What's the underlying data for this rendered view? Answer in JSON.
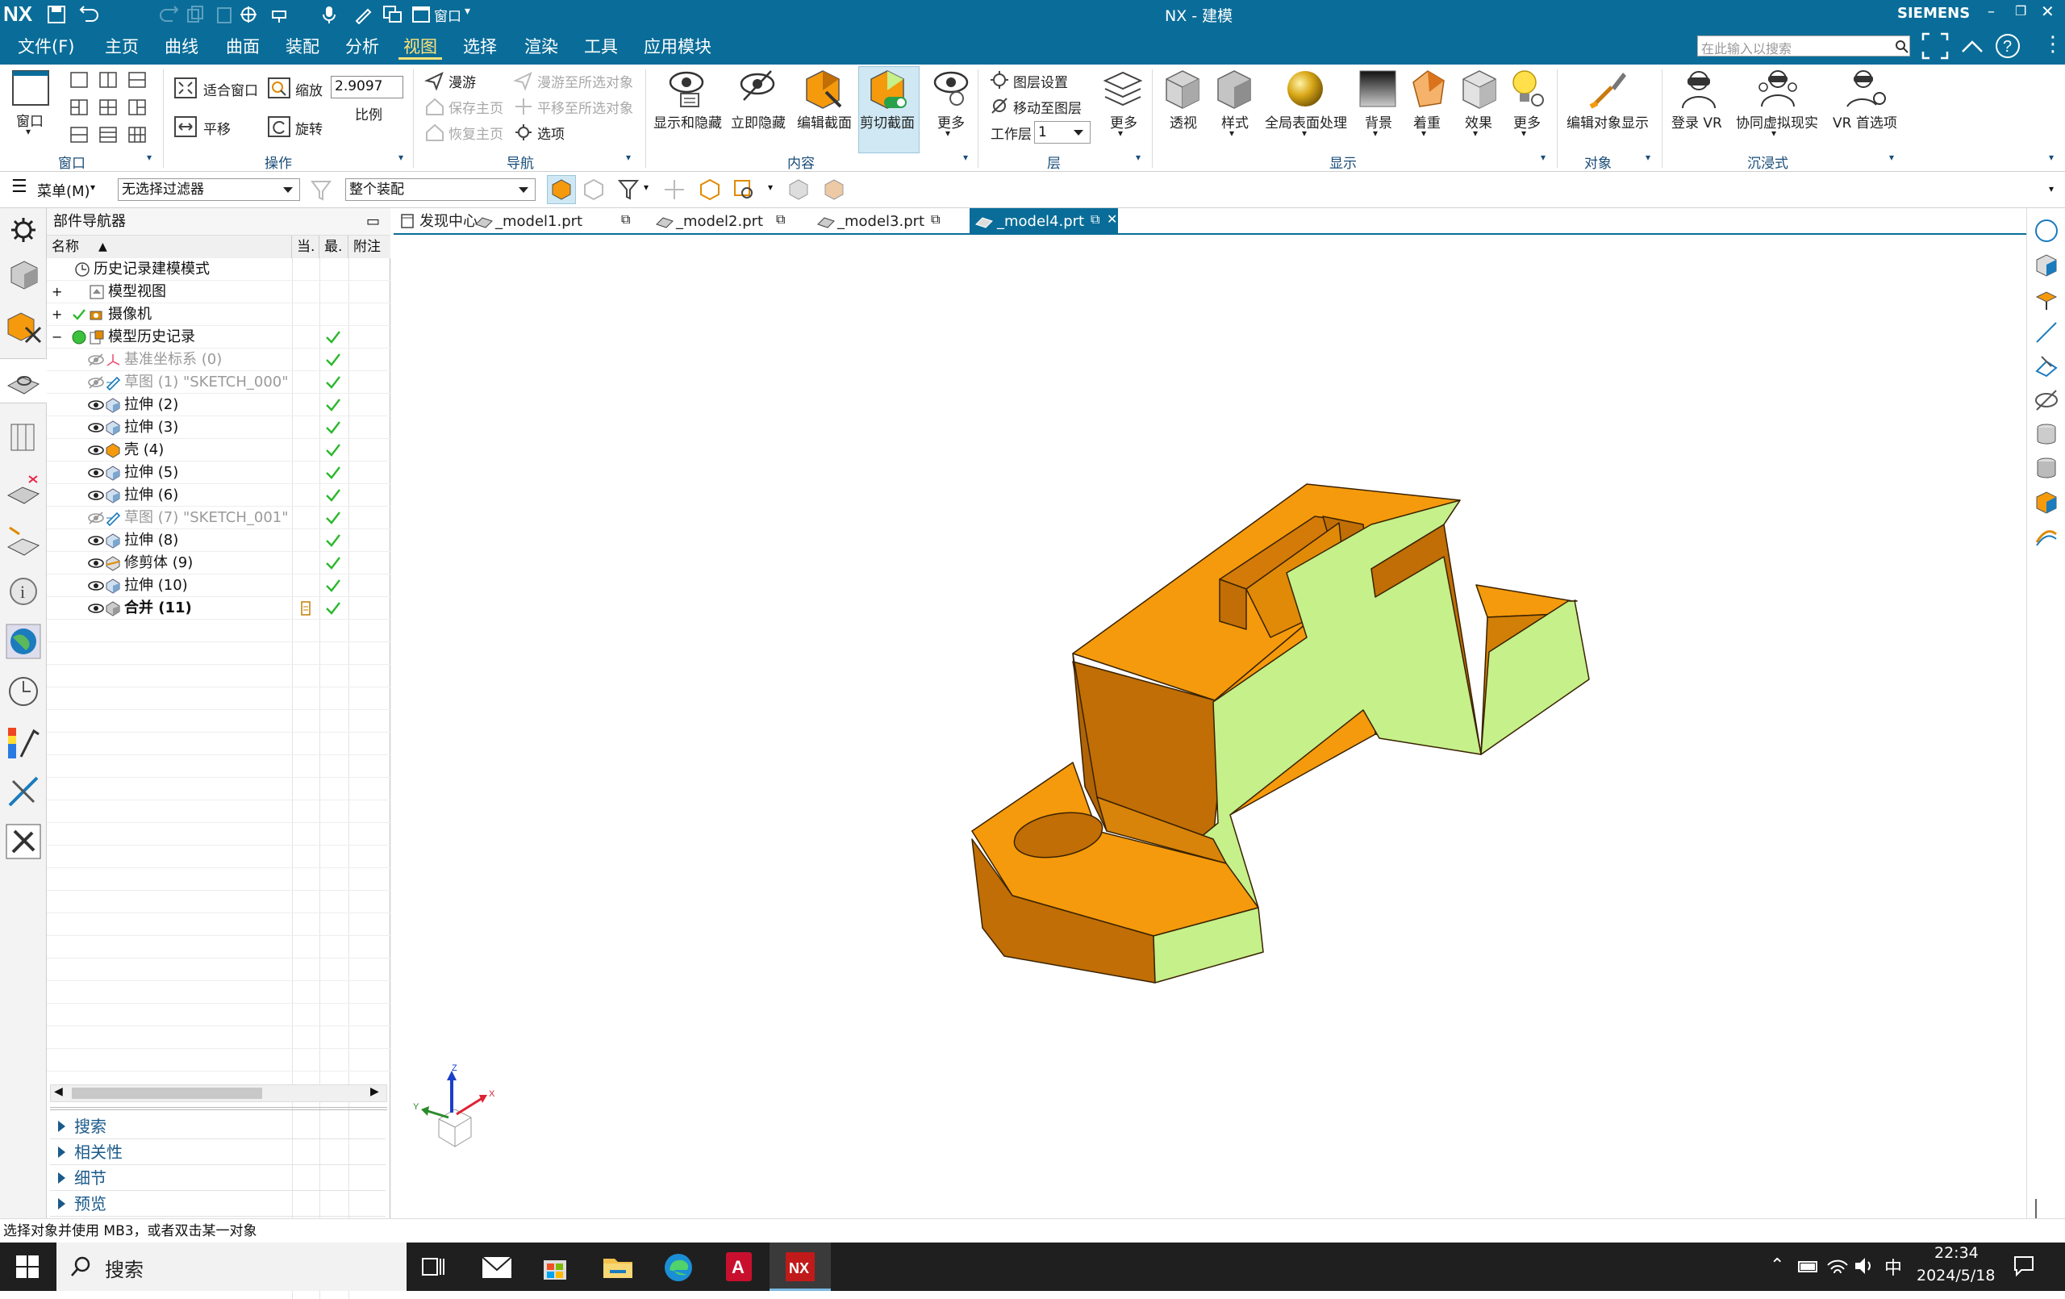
{
  "titlebar": {
    "app_logo": "NX",
    "title": "NX - 建模",
    "brand": "SIEMENS",
    "window_label": "窗口"
  },
  "menubar": {
    "items": [
      "文件(F)",
      "主页",
      "曲线",
      "曲面",
      "装配",
      "分析",
      "视图",
      "选择",
      "渲染",
      "工具",
      "应用模块"
    ],
    "active_index": 6,
    "search_placeholder": "在此输入以搜索"
  },
  "ribbon": {
    "window_group": {
      "button": "窗口",
      "label": "窗口"
    },
    "operation_group": {
      "fit_window": "适合窗口",
      "zoom": "缩放",
      "zoom_value": "2.9097",
      "scale": "比例",
      "pan": "平移",
      "rotate": "旋转",
      "label": "操作"
    },
    "navigation_group": {
      "roam": "漫游",
      "save_home": "保存主页",
      "restore_home": "恢复主页",
      "roam_to_selected": "漫游至所选对象",
      "pan_to_selected": "平移至所选对象",
      "options": "选项",
      "label": "导航"
    },
    "content_group": {
      "show_hide": "显示和隐藏",
      "hide_now": "立即隐藏",
      "edit_section": "编辑截面",
      "clip_section": "剪切截面",
      "more": "更多",
      "label": "内容"
    },
    "layer_group": {
      "layer_settings": "图层设置",
      "move_to_layer": "移动至图层",
      "work_layer": "工作层",
      "work_layer_value": "1",
      "more": "更多",
      "label": "层"
    },
    "display_group": {
      "perspective": "透视",
      "style": "样式",
      "global_surface": "全局表面处理",
      "background": "背景",
      "shading": "着重",
      "effects": "效果",
      "more": "更多",
      "label": "显示"
    },
    "object_group": {
      "edit_display": "编辑对象显示",
      "label": "对象"
    },
    "immersive_group": {
      "login_vr": "登录 VR",
      "collab_vr": "协同虚拟现实",
      "vr_prefs": "VR 首选项",
      "label": "沉浸式"
    }
  },
  "selection_bar": {
    "menu": "菜单(M)",
    "filter": "无选择过滤器",
    "scope": "整个装配"
  },
  "navigator": {
    "title": "部件导航器",
    "columns": [
      "名称",
      "当.",
      "最.",
      "附注"
    ],
    "rows": [
      {
        "label": "历史记录建模模式",
        "indent": 0,
        "checked": false,
        "dim": false,
        "bold": false
      },
      {
        "label": "模型视图",
        "indent": 0,
        "checked": false,
        "dim": false,
        "bold": false
      },
      {
        "label": "摄像机",
        "indent": 0,
        "checked": false,
        "dim": false,
        "bold": false
      },
      {
        "label": "模型历史记录",
        "indent": 0,
        "checked": true,
        "dim": false,
        "bold": false
      },
      {
        "label": "基准坐标系 (0)",
        "indent": 1,
        "checked": true,
        "dim": true,
        "bold": false
      },
      {
        "label": "草图 (1) \"SKETCH_000\"",
        "indent": 1,
        "checked": true,
        "dim": true,
        "bold": false
      },
      {
        "label": "拉伸 (2)",
        "indent": 1,
        "checked": true,
        "dim": false,
        "bold": false
      },
      {
        "label": "拉伸 (3)",
        "indent": 1,
        "checked": true,
        "dim": false,
        "bold": false
      },
      {
        "label": "壳 (4)",
        "indent": 1,
        "checked": true,
        "dim": false,
        "bold": false
      },
      {
        "label": "拉伸 (5)",
        "indent": 1,
        "checked": true,
        "dim": false,
        "bold": false
      },
      {
        "label": "拉伸 (6)",
        "indent": 1,
        "checked": true,
        "dim": false,
        "bold": false
      },
      {
        "label": "草图 (7) \"SKETCH_001\"",
        "indent": 1,
        "checked": true,
        "dim": true,
        "bold": false
      },
      {
        "label": "拉伸 (8)",
        "indent": 1,
        "checked": true,
        "dim": false,
        "bold": false
      },
      {
        "label": "修剪体 (9)",
        "indent": 1,
        "checked": true,
        "dim": false,
        "bold": false
      },
      {
        "label": "拉伸 (10)",
        "indent": 1,
        "checked": true,
        "dim": false,
        "bold": false
      },
      {
        "label": "合并 (11)",
        "indent": 1,
        "checked": true,
        "dim": false,
        "bold": true
      }
    ],
    "sections": [
      "搜索",
      "相关性",
      "细节",
      "预览"
    ]
  },
  "tabs": [
    {
      "label": "发现中心",
      "active": false
    },
    {
      "label": "_model1.prt",
      "active": false
    },
    {
      "label": "_model2.prt",
      "active": false
    },
    {
      "label": "_model3.prt",
      "active": false
    },
    {
      "label": "_model4.prt",
      "active": true
    }
  ],
  "viewport": {
    "triad": {
      "x": "X",
      "y": "Y",
      "z": "Z"
    },
    "model_colors": {
      "face": "#f59a0c",
      "shadow": "#c06e05",
      "cut": "#c5f08a"
    }
  },
  "statusbar": {
    "message": "选择对象并使用 MB3，或者双击某一对象"
  },
  "taskbar": {
    "search": "搜索",
    "ime": "中",
    "time": "22:34",
    "date": "2024/5/18"
  },
  "colors": {
    "accent": "#0a6d99",
    "check": "#2db82d"
  }
}
